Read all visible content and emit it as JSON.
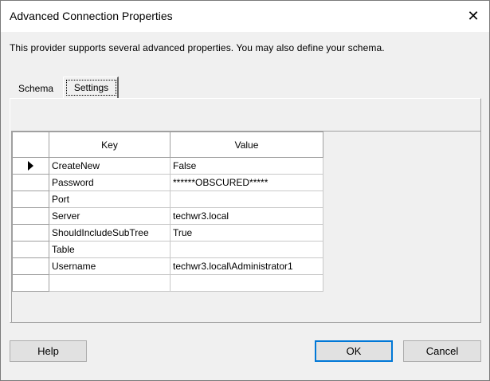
{
  "window": {
    "title": "Advanced Connection Properties",
    "close_glyph": "✕"
  },
  "description": "This provider supports several advanced properties.  You may also define your schema.",
  "tabs": [
    {
      "label": "Schema",
      "selected": false
    },
    {
      "label": "Settings",
      "selected": true
    }
  ],
  "grid": {
    "columns": [
      "Key",
      "Value"
    ],
    "current_row_index": 0,
    "rows": [
      {
        "key": "CreateNew",
        "value": "False"
      },
      {
        "key": "Password",
        "value": "******OBSCURED*****"
      },
      {
        "key": "Port",
        "value": ""
      },
      {
        "key": "Server",
        "value": "techwr3.local"
      },
      {
        "key": "ShouldIncludeSubTree",
        "value": "True"
      },
      {
        "key": "Table",
        "value": ""
      },
      {
        "key": "Username",
        "value": "techwr3.local\\Administrator1"
      },
      {
        "key": "",
        "value": ""
      }
    ]
  },
  "buttons": {
    "help": "Help",
    "ok": "OK",
    "cancel": "Cancel"
  },
  "colors": {
    "dialog_bg": "#f0f0f0",
    "focus_border": "#0078d7"
  }
}
